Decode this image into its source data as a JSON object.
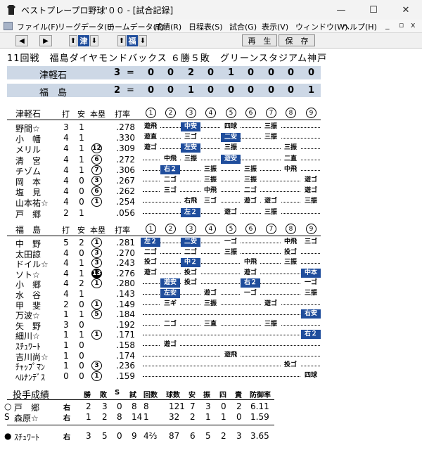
{
  "window": {
    "title": "ベストプレープロ野球'００ - [試合記録]",
    "minimize": "—",
    "maximize": "☐",
    "close": "✕"
  },
  "menu": [
    "ファイル(F)",
    "リーグデータ(L)",
    "チームデータ(T)",
    "成績(R)",
    "日程表(S)",
    "試合(G)",
    "表示(V)",
    "ウィンドウ(W)",
    "ヘルプ(H)"
  ],
  "mdi_controls": [
    "_",
    "ⅹ"
  ],
  "toolbar": {
    "team1": "津",
    "team2": "福",
    "play": "再　生",
    "save": "保　存"
  },
  "game_info": "11回戦　福島ダイヤモンドバックス ６勝５敗　グリーンスタジアム神戸",
  "scoreboard": [
    {
      "team": "津軽石",
      "runs": "3",
      "eq": "=",
      "innings": [
        "0",
        "0",
        "2",
        "0",
        "1",
        "0",
        "0",
        "0",
        "0"
      ]
    },
    {
      "team": "福　島",
      "runs": "2",
      "eq": "=",
      "innings": [
        "0",
        "0",
        "1",
        "0",
        "0",
        "0",
        "0",
        "0",
        "1"
      ]
    }
  ],
  "batting_headers": {
    "ab": "打",
    "hits": "安",
    "hr": "本塁",
    "avg": "打率"
  },
  "inning_labels": [
    "1",
    "2",
    "3",
    "4",
    "5",
    "6",
    "7",
    "8",
    "9"
  ],
  "away": {
    "team": "津軽石",
    "players": [
      {
        "name": "野間☆",
        "ab": "3",
        "h": "1",
        "hr": "",
        "avg": ".278",
        "cells": [
          {
            "i": 0,
            "t": "遊飛"
          },
          {
            "i": 2,
            "t": "中安",
            "hl": true
          },
          {
            "i": 4,
            "t": "四球"
          },
          {
            "i": 6,
            "t": "三振"
          }
        ]
      },
      {
        "name": "小　幡",
        "ab": "4",
        "h": "1",
        "hr": "",
        "avg": ".330",
        "cells": [
          {
            "i": 0,
            "t": "遊直"
          },
          {
            "i": 2,
            "t": "三ゴ"
          },
          {
            "i": 4,
            "t": "二安",
            "hl": true
          },
          {
            "i": 6,
            "t": "三振"
          }
        ]
      },
      {
        "name": "メリル",
        "ab": "4",
        "h": "1",
        "hr": "12",
        "avg": ".309",
        "cells": [
          {
            "i": 0,
            "t": "遊ゴ"
          },
          {
            "i": 2,
            "t": "左安",
            "hl": true
          },
          {
            "i": 4,
            "t": "三振"
          },
          {
            "i": 7,
            "t": "三振"
          }
        ]
      },
      {
        "name": "清　宮",
        "ab": "4",
        "h": "1",
        "hr": "6",
        "avg": ".272",
        "cells": [
          {
            "i": 1,
            "t": "中飛"
          },
          {
            "i": 2,
            "t": "三振"
          },
          {
            "i": 4,
            "t": "遊安",
            "hl": true
          },
          {
            "i": 7,
            "t": "二直"
          }
        ]
      },
      {
        "name": "チゾム",
        "ab": "4",
        "h": "1",
        "hr": "7",
        "avg": ".306",
        "cells": [
          {
            "i": 1,
            "t": "右２",
            "hl": true
          },
          {
            "i": 3,
            "t": "三振"
          },
          {
            "i": 5,
            "t": "三振"
          },
          {
            "i": 7,
            "t": "中飛"
          }
        ]
      },
      {
        "name": "岡　本",
        "ab": "4",
        "h": "0",
        "hr": "3",
        "avg": ".267",
        "cells": [
          {
            "i": 1,
            "t": "二ゴ"
          },
          {
            "i": 3,
            "t": "三振"
          },
          {
            "i": 5,
            "t": "三振"
          },
          {
            "i": 8,
            "t": "遊ゴ"
          }
        ]
      },
      {
        "name": "塩　見",
        "ab": "4",
        "h": "0",
        "hr": "6",
        "avg": ".262",
        "cells": [
          {
            "i": 1,
            "t": "三ゴ"
          },
          {
            "i": 3,
            "t": "中飛"
          },
          {
            "i": 5,
            "t": "二ゴ"
          },
          {
            "i": 8,
            "t": "遊ゴ"
          }
        ]
      },
      {
        "name": "山本祐☆",
        "ab": "4",
        "h": "0",
        "hr": "1",
        "avg": ".254",
        "cells": [
          {
            "i": 2,
            "t": "右飛"
          },
          {
            "i": 3,
            "t": "三ゴ"
          },
          {
            "i": 5,
            "t": "遊ゴ"
          },
          {
            "i": 6,
            "t": "遊ゴ"
          },
          {
            "i": 8,
            "t": "三振"
          }
        ]
      },
      {
        "name": "戸　郷",
        "ab": "2",
        "h": "1",
        "hr": "",
        "avg": ".056",
        "cells": [
          {
            "i": 2,
            "t": "左２",
            "hl": true
          },
          {
            "i": 4,
            "t": "遊ゴ"
          },
          {
            "i": 6,
            "t": "三振"
          }
        ]
      }
    ]
  },
  "home": {
    "team": "福　島",
    "players": [
      {
        "name": "中　野",
        "ab": "5",
        "h": "2",
        "hr": "1",
        "hr_filled": false,
        "avg": ".281",
        "cells": [
          {
            "i": 0,
            "t": "左２",
            "hl": true
          },
          {
            "i": 2,
            "t": "二安",
            "hl": true
          },
          {
            "i": 4,
            "t": "一ゴ"
          },
          {
            "i": 7,
            "t": "中飛"
          },
          {
            "i": 8,
            "t": "三ゴ"
          }
        ]
      },
      {
        "name": "太田諒",
        "ab": "4",
        "h": "0",
        "hr": "3",
        "avg": ".270",
        "cells": [
          {
            "i": 0,
            "t": "二ゴ"
          },
          {
            "i": 2,
            "t": "二ゴ"
          },
          {
            "i": 4,
            "t": "三振"
          },
          {
            "i": 7,
            "t": "投ゴ"
          }
        ]
      },
      {
        "name": "ドイル☆",
        "ab": "4",
        "h": "1",
        "hr": "3",
        "avg": ".243",
        "cells": [
          {
            "i": 0,
            "t": "投ゴ"
          },
          {
            "i": 2,
            "t": "中２",
            "hl": true
          },
          {
            "i": 5,
            "t": "中飛"
          },
          {
            "i": 7,
            "t": "三振"
          }
        ]
      },
      {
        "name": "ソト☆",
        "ab": "4",
        "h": "1",
        "hr": "13",
        "hr_filled": true,
        "avg": ".276",
        "cells": [
          {
            "i": 0,
            "t": "遊ゴ"
          },
          {
            "i": 2,
            "t": "投ゴ"
          },
          {
            "i": 5,
            "t": "遊ゴ"
          },
          {
            "i": 8,
            "t": "中本",
            "hl": true
          }
        ]
      },
      {
        "name": "小　郷",
        "ab": "4",
        "h": "2",
        "hr": "1",
        "avg": ".280",
        "cells": [
          {
            "i": 1,
            "t": "遊安",
            "hl": true
          },
          {
            "i": 2,
            "t": "投ゴ"
          },
          {
            "i": 5,
            "t": "右２",
            "hl": true
          },
          {
            "i": 8,
            "t": "一ゴ"
          }
        ]
      },
      {
        "name": "水　谷",
        "ab": "4",
        "h": "1",
        "hr": "",
        "avg": ".143",
        "cells": [
          {
            "i": 1,
            "t": "左安",
            "hl": true
          },
          {
            "i": 3,
            "t": "遊ゴ"
          },
          {
            "i": 5,
            "t": "一ゴ"
          },
          {
            "i": 8,
            "t": "三振"
          }
        ]
      },
      {
        "name": "甲　斐",
        "ab": "2",
        "h": "0",
        "hr": "1",
        "avg": ".149",
        "cells": [
          {
            "i": 1,
            "t": "三ギ"
          },
          {
            "i": 3,
            "t": "三振"
          },
          {
            "i": 6,
            "t": "遊ゴ"
          }
        ]
      },
      {
        "name": "万波☆",
        "ab": "1",
        "h": "1",
        "hr": "5",
        "avg": ".184",
        "cells": [
          {
            "i": 8,
            "t": "右安",
            "hl": true
          }
        ]
      },
      {
        "name": "矢　野",
        "ab": "3",
        "h": "0",
        "hr": "",
        "avg": ".192",
        "cells": [
          {
            "i": 1,
            "t": "二ゴ"
          },
          {
            "i": 3,
            "t": "三直"
          },
          {
            "i": 6,
            "t": "三振"
          }
        ]
      },
      {
        "name": "細川☆",
        "ab": "1",
        "h": "1",
        "hr": "1",
        "avg": ".171",
        "cells": [
          {
            "i": 8,
            "t": "右２",
            "hl": true
          }
        ]
      },
      {
        "name": "ｽﾁｭﾜｰﾄ",
        "ab": "1",
        "h": "0",
        "hr": "",
        "avg": ".158",
        "cells": [
          {
            "i": 1,
            "t": "遊ゴ"
          }
        ]
      },
      {
        "name": "吉川尚☆",
        "ab": "1",
        "h": "0",
        "hr": "",
        "avg": ".174",
        "cells": [
          {
            "i": 4,
            "t": "遊飛"
          }
        ]
      },
      {
        "name": "ﾁｬｯﾌﾟﾏﾝ",
        "ab": "1",
        "h": "0",
        "hr": "3",
        "avg": ".236",
        "cells": [
          {
            "i": 7,
            "t": "投ゴ"
          }
        ]
      },
      {
        "name": "ﾍﾙﾅﾝﾃﾞｽ",
        "ab": "0",
        "h": "0",
        "hr": "1",
        "avg": ".159",
        "cells": [
          {
            "i": 8,
            "t": "四球"
          }
        ]
      }
    ]
  },
  "pitching": {
    "title": "投手成績",
    "headers": [
      "勝",
      "敗",
      "S",
      "試",
      "回数",
      "球数",
      "安",
      "振",
      "四",
      "責",
      "防御率"
    ],
    "rows": [
      {
        "mark": "○",
        "name": "戸　郷",
        "hand": "右",
        "w": "2",
        "l": "3",
        "s": "0",
        "g": "8",
        "ip": "8",
        "np": "121",
        "h": "7",
        "k": "3",
        "bb": "0",
        "er": "2",
        "era": "6.11"
      },
      {
        "mark": "S",
        "name": "森原☆",
        "hand": "右",
        "w": "1",
        "l": "2",
        "s": "8",
        "g": "14",
        "ip": "1",
        "np": "32",
        "h": "2",
        "k": "1",
        "bb": "1",
        "er": "0",
        "era": "1.59"
      },
      {
        "mark": "●",
        "name": "ｽﾁｭﾜｰﾄ",
        "hand": "右",
        "w": "3",
        "l": "5",
        "s": "0",
        "g": "9",
        "ip": "4⅔",
        "np": "87",
        "h": "6",
        "k": "5",
        "bb": "2",
        "er": "3",
        "era": "3.65"
      }
    ]
  }
}
